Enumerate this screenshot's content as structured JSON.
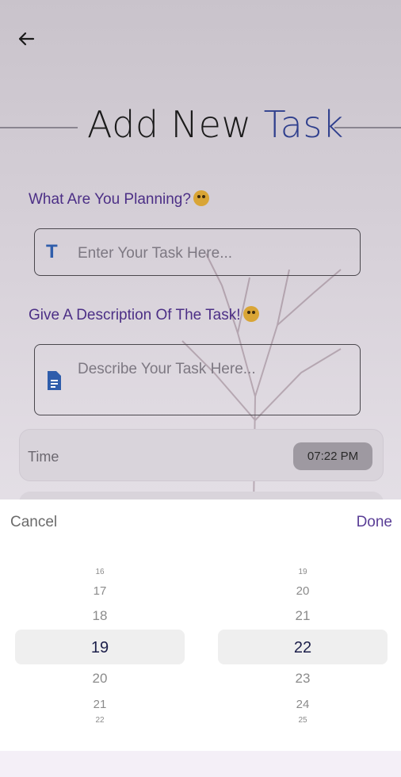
{
  "header": {
    "title_main": "Add New ",
    "title_accent": "Task"
  },
  "form": {
    "task_label": "What Are You Planning?",
    "task_placeholder": "Enter Your Task Here...",
    "description_label": "Give A Description Of The Task!",
    "description_placeholder": "Describe Your Task Here...",
    "time_label": "Time",
    "time_value": "07:22 PM"
  },
  "picker": {
    "cancel_label": "Cancel",
    "done_label": "Done",
    "hours": {
      "above": [
        "16",
        "17",
        "18"
      ],
      "selected": "19",
      "below": [
        "20",
        "21",
        "22"
      ]
    },
    "minutes": {
      "above": [
        "19",
        "20",
        "21"
      ],
      "selected": "22",
      "below": [
        "23",
        "24",
        "25"
      ]
    }
  },
  "colors": {
    "accent": "#2f3f8d",
    "label": "#4c2f86",
    "done": "#5a3e96"
  }
}
